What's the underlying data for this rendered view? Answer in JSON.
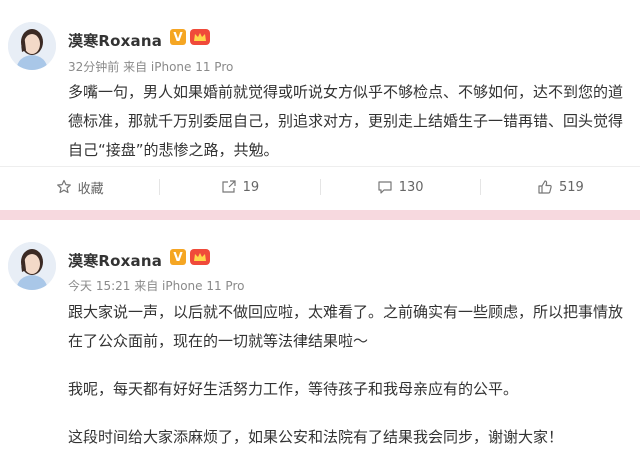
{
  "posts": [
    {
      "user": {
        "name": "漠寒Roxana",
        "vip_badge": "V"
      },
      "meta": "32分钟前 来自 iPhone 11 Pro",
      "paragraphs": [
        "多嘴一句，男人如果婚前就觉得或听说女方似乎不够检点、不够如何，达不到您的道德标准，那就千万别委屈自己，别追求对方，更别走上结婚生子一错再错、回头觉得自己“接盘”的悲惨之路，共勉。"
      ],
      "actions": {
        "favorite": "收藏",
        "repost": "19",
        "comment": "130",
        "like": "519"
      }
    },
    {
      "user": {
        "name": "漠寒Roxana",
        "vip_badge": "V"
      },
      "meta": "今天 15:21 来自 iPhone 11 Pro",
      "paragraphs": [
        "跟大家说一声，以后就不做回应啦，太难看了。之前确实有一些顾虑，所以把事情放在了公众面前，现在的一切就等法律结果啦～",
        "我呢，每天都有好好生活努力工作，等待孩子和我母亲应有的公平。",
        "这段时间给大家添麻烦了，如果公安和法院有了结果我会同步，谢谢大家！"
      ]
    }
  ],
  "icons": [
    "star-icon",
    "repost-icon",
    "comment-icon",
    "like-icon",
    "crown-icon"
  ],
  "colors": {
    "divider": "#f7d9df",
    "vip": "#f5a623",
    "crown": "#f04a3a",
    "meta": "#8a8a8a"
  }
}
